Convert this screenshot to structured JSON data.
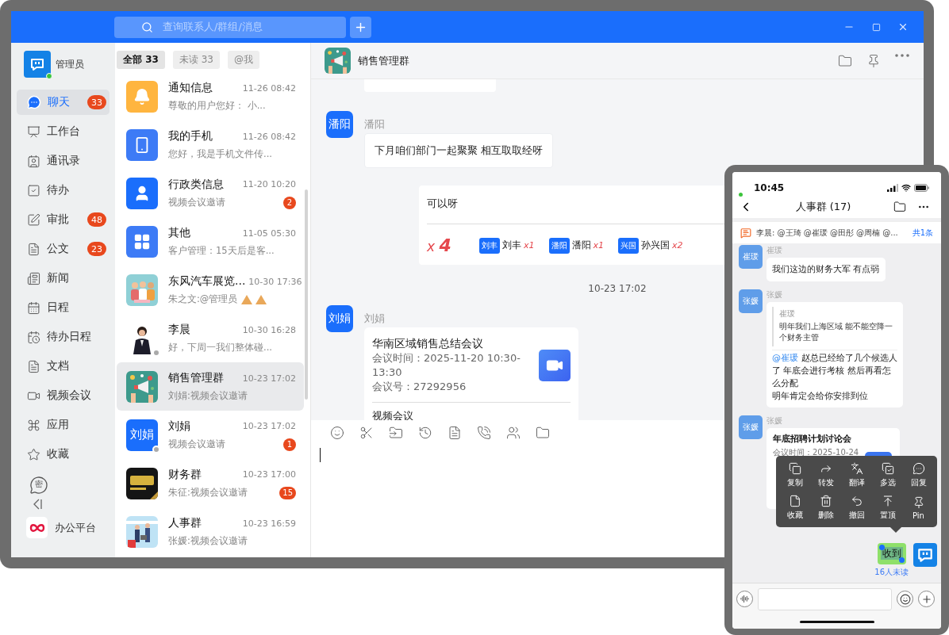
{
  "topbar": {
    "search": {
      "placeholder": "查询联系人/群组/消息"
    }
  },
  "user": {
    "name": "管理员",
    "online": true
  },
  "nav": [
    {
      "label": "聊天",
      "selected": true,
      "badge": "33"
    },
    {
      "label": "工作台",
      "selected": false
    },
    {
      "label": "通讯录",
      "selected": false
    },
    {
      "label": "待办",
      "selected": false
    },
    {
      "label": "审批",
      "selected": false,
      "badge": "48"
    },
    {
      "label": "公文",
      "selected": false,
      "badge": "23"
    },
    {
      "label": "新闻",
      "selected": false
    },
    {
      "label": "日程",
      "selected": false
    },
    {
      "label": "待办日程",
      "selected": false
    },
    {
      "label": "文档",
      "selected": false
    },
    {
      "label": "视频会议",
      "selected": false
    },
    {
      "label": "应用",
      "selected": false
    },
    {
      "label": "收藏",
      "selected": false
    }
  ],
  "secure_label": "密",
  "platform": {
    "label": "办公平台"
  },
  "list_tabs": [
    {
      "label": "全部 33",
      "selected": true
    },
    {
      "label": "未读 33",
      "selected": false
    },
    {
      "label": "@我",
      "selected": false
    }
  ],
  "chats": [
    {
      "avatar": {
        "kind": "bell",
        "color": "#ffb53f"
      },
      "name": "通知信息",
      "time": "11-26 08:42",
      "preview": "尊敬的用户您好：  小...",
      "selected": false,
      "away": false
    },
    {
      "avatar": {
        "kind": "phone",
        "color": "#3d7bf6"
      },
      "name": "我的手机",
      "time": "11-26 08:42",
      "preview": "您好，我是手机文件传...",
      "selected": false,
      "away": false
    },
    {
      "avatar": {
        "kind": "staff",
        "color": "#1a6efc"
      },
      "name": "行政类信息",
      "time": "11-20 10:20",
      "preview": "视频会议邀请",
      "badge": "2",
      "selected": false,
      "away": false
    },
    {
      "avatar": {
        "kind": "apps",
        "color": "#3d7bf6"
      },
      "name": "其他",
      "time": "11-05 05:30",
      "preview": "客户管理：15天后是客...",
      "selected": false,
      "away": false
    },
    {
      "name": "东风汽车展览...",
      "time": "10-30 17:36",
      "preview": "朱之文:@管理员",
      "claps": true,
      "selected": false,
      "away": false
    },
    {
      "name": "李晨",
      "time": "10-30 16:28",
      "preview": "好，下周一我们整体碰...",
      "selected": false,
      "away": true
    },
    {
      "name": "销售管理群",
      "time": "10-23 17:02",
      "preview": "刘娟:视频会议邀请",
      "selected": true,
      "away": false
    },
    {
      "avatar": {
        "kind": "text",
        "text": "刘娟",
        "color": "#1a6efc"
      },
      "name": "刘娟",
      "time": "10-23 17:02",
      "preview": "视频会议邀请",
      "badge": "1",
      "selected": false,
      "away": true
    },
    {
      "name": "财务群",
      "time": "10-23 17:00",
      "preview": "朱征:视频会议邀请",
      "badge": "15",
      "selected": false,
      "away": false
    },
    {
      "name": "人事群",
      "time": "10-23 16:59",
      "preview": "张媛:视频会议邀请",
      "selected": false,
      "away": false
    }
  ],
  "chat": {
    "title": "销售管理群",
    "messages": [
      {
        "kind": "clipped"
      },
      {
        "kind": "text",
        "sender": "潘阳",
        "avatar_text": "潘阳",
        "text": "下月咱们部门一起聚聚 相互取取经呀"
      },
      {
        "kind": "reactions",
        "text": "可以呀",
        "total": "x **4**",
        "reactions": [
          {
            "avatar_text": "刘丰",
            "name": "刘丰",
            "count": "x1"
          },
          {
            "avatar_text": "潘阳",
            "name": "潘阳",
            "count": "x1"
          },
          {
            "avatar_text": "兴国",
            "name": "孙兴国",
            "count": "x2"
          }
        ]
      },
      {
        "kind": "time",
        "text": "10-23 17:02"
      },
      {
        "kind": "meeting",
        "sender": "刘娟",
        "avatar_text": "刘娟",
        "title": "华南区域销售总结会议",
        "lines": [
          "会议时间：2025-11-20 10:30-13:30",
          "会议号：27292956"
        ],
        "footer": "视频会议"
      }
    ]
  },
  "phone": {
    "time": "10:45",
    "title": "人事群 (17)",
    "notice": {
      "text": "李晨: @王琦 @崔瑗 @田彤 @周楠 @...",
      "count": "共1条"
    },
    "messages": [
      {
        "kind": "text",
        "sender": "崔瑗",
        "avatar_text": "崔瑗",
        "text": "我们这边的财务大军 有点弱"
      },
      {
        "kind": "reply",
        "sender": "张媛",
        "avatar_text": "张媛",
        "quote_sender": "崔瑗",
        "quote": "明年我们上海区域   能不能空降一个财务主管",
        "mention": "@崔瑗",
        "text": "赵总已经给了几个候选人了   年底会进行考核   然后再看怎么分配",
        "text_after": "明年肯定会给你安排到位"
      },
      {
        "kind": "meeting",
        "sender": "张媛",
        "avatar_text": "张媛",
        "title": "年底招聘计划讨论会",
        "lines": [
          "会议时间：2025-10-24"
        ]
      }
    ],
    "menu": [
      {
        "label": "复制"
      },
      {
        "label": "转发"
      },
      {
        "label": "翻译"
      },
      {
        "label": "多选"
      },
      {
        "label": "回复"
      },
      {
        "label": "收藏"
      },
      {
        "label": "删除"
      },
      {
        "label": "撤回"
      },
      {
        "label": "置顶"
      },
      {
        "label": "Pin"
      }
    ],
    "own": {
      "text": "收到",
      "status": "16人未读"
    }
  }
}
